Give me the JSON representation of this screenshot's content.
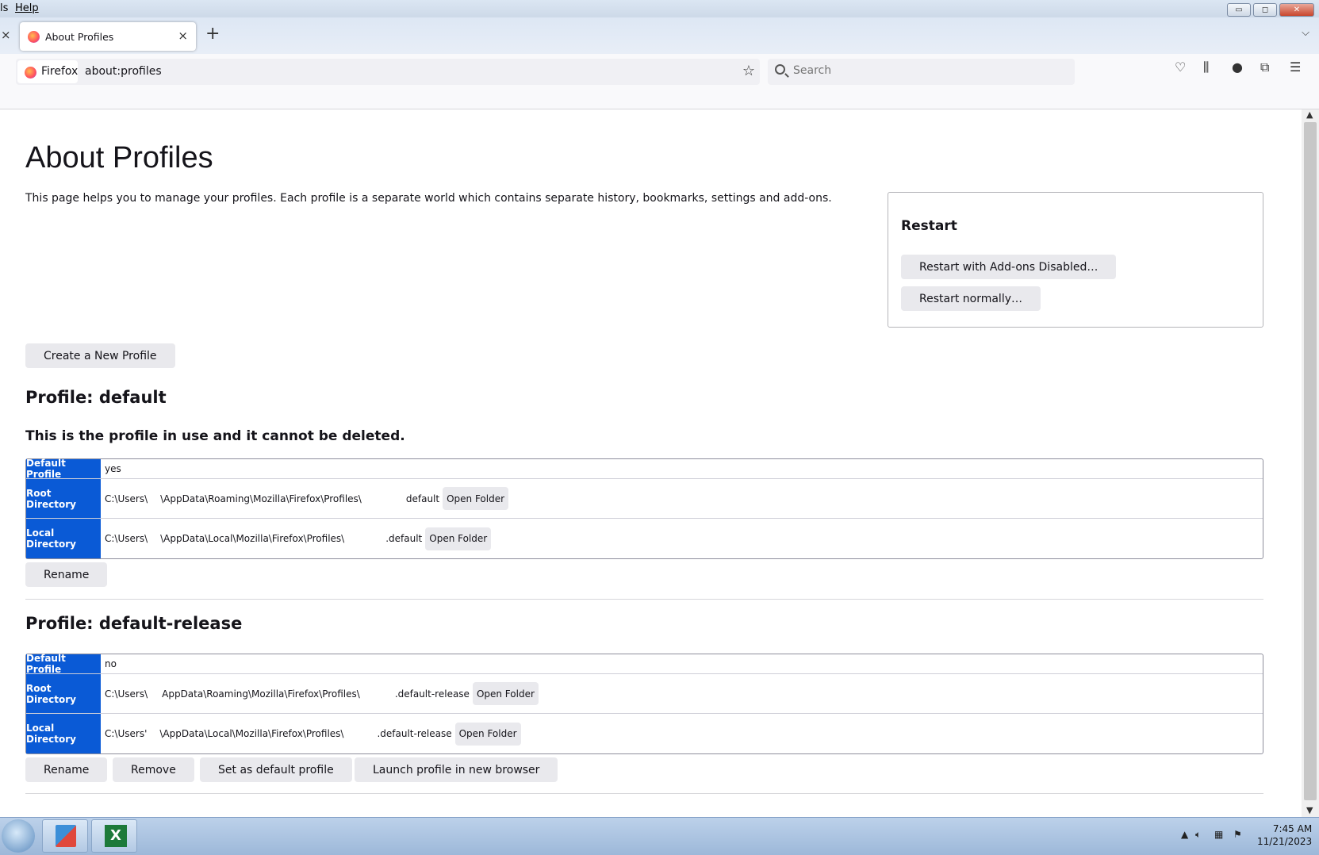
{
  "menubar": {
    "items": [
      "ls",
      "Help"
    ]
  },
  "window_controls": {
    "minimize": "▭",
    "maximize": "◻",
    "close": "✕"
  },
  "tab": {
    "title": "About Profiles",
    "close": "×"
  },
  "tabstrip": {
    "new_tab": "+",
    "list_all": "⌵",
    "close_left": "×"
  },
  "navbar": {
    "identity_label": "Firefox",
    "url": "about:profiles",
    "search_placeholder": "Search"
  },
  "toolbar_icons": [
    "pocket-icon",
    "library-icon",
    "account-icon",
    "extensions-icon",
    "menu-icon"
  ],
  "page": {
    "title": "About Profiles",
    "description": "This page helps you to manage your profiles. Each profile is a separate world which contains separate history, bookmarks, settings and add-ons.",
    "create_button": "Create a New Profile"
  },
  "restart": {
    "heading": "Restart",
    "disabled_button": "Restart with Add-ons Disabled…",
    "normal_button": "Restart normally…"
  },
  "profiles": [
    {
      "heading": "Profile: default",
      "in_use_note": "This is the profile in use and it cannot be deleted.",
      "rows": {
        "default_label": "Default Profile",
        "default_value": "yes",
        "root_label": "Root Directory",
        "root_prefix": "C:\\Users\\",
        "root_mid": "\\AppData\\Roaming\\Mozilla\\Firefox\\Profiles\\",
        "root_suffix": "default",
        "local_label": "Local Directory",
        "local_prefix": "C:\\Users\\",
        "local_mid": "\\AppData\\Local\\Mozilla\\Firefox\\Profiles\\",
        "local_suffix": ".default"
      },
      "open_folder": "Open Folder",
      "rename": "Rename"
    },
    {
      "heading": "Profile: default-release",
      "rows": {
        "default_label": "Default Profile",
        "default_value": "no",
        "root_label": "Root Directory",
        "root_prefix": "C:\\Users\\",
        "root_mid": "AppData\\Roaming\\Mozilla\\Firefox\\Profiles\\",
        "root_suffix": ".default-release",
        "local_label": "Local Directory",
        "local_prefix": "C:\\Users'",
        "local_mid": "\\AppData\\Local\\Mozilla\\Firefox\\Profiles\\",
        "local_suffix": ".default-release"
      },
      "open_folder": "Open Folder",
      "rename": "Rename",
      "remove": "Remove",
      "set_default": "Set as default profile",
      "launch": "Launch profile in new browser"
    }
  ],
  "taskbar": {
    "apps": [
      "control-panel-icon",
      "excel-icon"
    ],
    "time": "7:45 AM",
    "date": "11/21/2023"
  }
}
